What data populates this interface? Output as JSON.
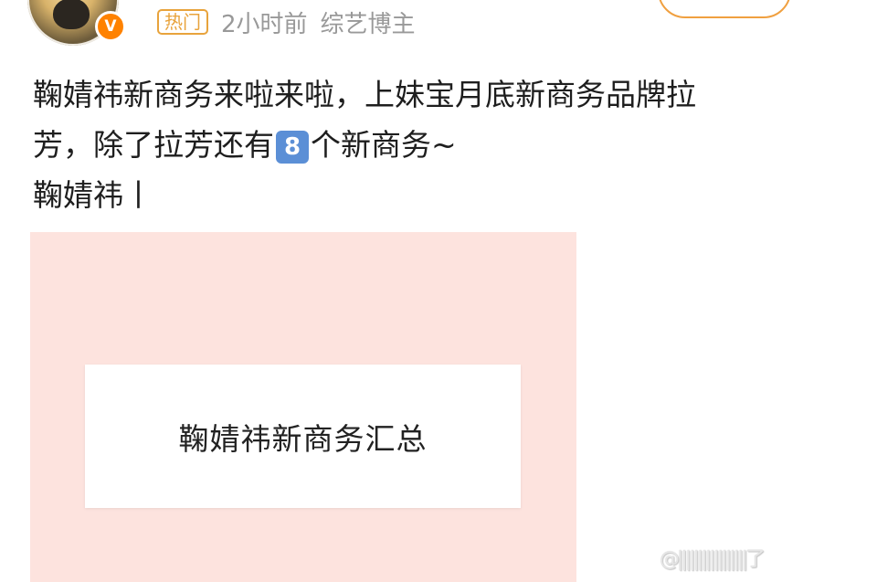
{
  "post": {
    "hot_tag": "热门",
    "time": "2小时前",
    "author_type": "综艺博主",
    "verified_badge": "V",
    "text": {
      "line1": "鞠婧祎新商务来啦来啦，上妹宝月底新商务品牌拉",
      "line2_pre": "芳，除了拉芳还有",
      "line2_emoji": "8",
      "line2_post": "个新商务~",
      "line3": "鞠婧祎丨"
    }
  },
  "image_card": {
    "title": "鞠婧祎新商务汇总",
    "background_color": "#fde3de"
  },
  "watermark": {
    "text": "@|||||||||||||||||了"
  },
  "colors": {
    "accent": "#ff8200",
    "hot_tag": "#e8a33c",
    "meta_text": "#999999"
  }
}
